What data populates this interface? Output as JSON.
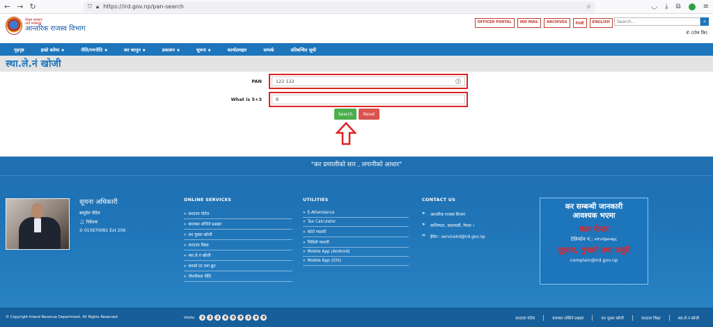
{
  "browser": {
    "url": "https://ird.gov.np/pan-search"
  },
  "header": {
    "logo_small_1": "नेपाल सरकार",
    "logo_small_2": "अर्थ मन्त्रालय",
    "logo_title": "आन्तरिक राजस्व विभाग",
    "top_links": [
      "OFFICER PORTAL",
      "IRD MAIL",
      "ARCHIVES",
      "नेपाली",
      "ENGLISH"
    ],
    "search_placeholder": "Search...",
    "tollfree": "(टोल फ्रि)"
  },
  "nav": {
    "items": [
      {
        "label": "गृहपृष्ठ",
        "dropdown": false
      },
      {
        "label": "हाम्रो बारेमा",
        "dropdown": true
      },
      {
        "label": "नीति/रणनीति",
        "dropdown": true
      },
      {
        "label": "कर कानून",
        "dropdown": true
      },
      {
        "label": "प्रकाशन",
        "dropdown": true
      },
      {
        "label": "सूचना",
        "dropdown": true
      },
      {
        "label": "कार्यालयहरु",
        "dropdown": false
      },
      {
        "label": "सम्पर्क",
        "dropdown": false
      },
      {
        "label": "प्रतिबन्धित सूची",
        "dropdown": false
      }
    ]
  },
  "page": {
    "title": "स्था.ले.नं खोजी"
  },
  "form": {
    "pan_label": "PAN",
    "pan_value": "122 122",
    "captcha_label": "What is 5+3",
    "captcha_value": "8",
    "search_label": "Search",
    "reset_label": "Reset",
    "annotation_color": "#e02020"
  },
  "footer": {
    "quote": "\"कर प्रणालीको सार , लगानीको आधार\"",
    "officer": {
      "title": "सूचना अधिकारी",
      "name": "बासुदेव पौडेल",
      "position": "निर्देशक",
      "phone": "015970081 Ext 206"
    },
    "online_services": {
      "heading": "ONLINE SERVICES",
      "items": [
        "करदाता पोर्टल",
        "बारम्बार सोधिने प्रश्नहरु",
        "कर चुक्ता खोजी",
        "करदाता शिक्षा",
        "स्था.ले.नं खोजी",
        "करको दर तथा छुट",
        "गोपनीयता नीति"
      ]
    },
    "utilities": {
      "heading": "UTILITIES",
      "items": [
        "E-Attendance",
        "Tax Calculator",
        "फोटो ग्यालरी",
        "भिडियो ग्यालरी",
        "Mobile App (Android)",
        "Mobile App (IOS)"
      ]
    },
    "contact": {
      "heading": "CONTACT US",
      "office": "आन्तरिक राजस्व विभाग",
      "address": "लाजिम्पाट, काठमाडौं, नेपाल ।",
      "email": "ईमेल : serviceird@ird.gov.np"
    },
    "callbox": {
      "line1": "कर सम्बन्धी जानकारी",
      "line2": "आवश्यक भएमा",
      "call_center": "कल सेन्टर",
      "phone": "टेलिफोन नं.: ०१५९७००७८",
      "suggestion": "सुझाव, गुनासो तथा उजुरी",
      "email": "complain@ird.gov.np"
    },
    "copyright": "© Copyright Inland Revenue Department. All Rights Reserved",
    "visits_label": "Visits:",
    "visits_digits": [
      "1",
      "2",
      "2",
      "6",
      "0",
      "9",
      "2",
      "8",
      "8"
    ],
    "bottom_links": [
      "करदाता पोर्टल",
      "बारम्बार सोधिने प्रश्नहरु",
      "कर चुक्ता खोजी",
      "करदाता शिक्षा",
      "स्था.ले.नं खोजी"
    ]
  }
}
